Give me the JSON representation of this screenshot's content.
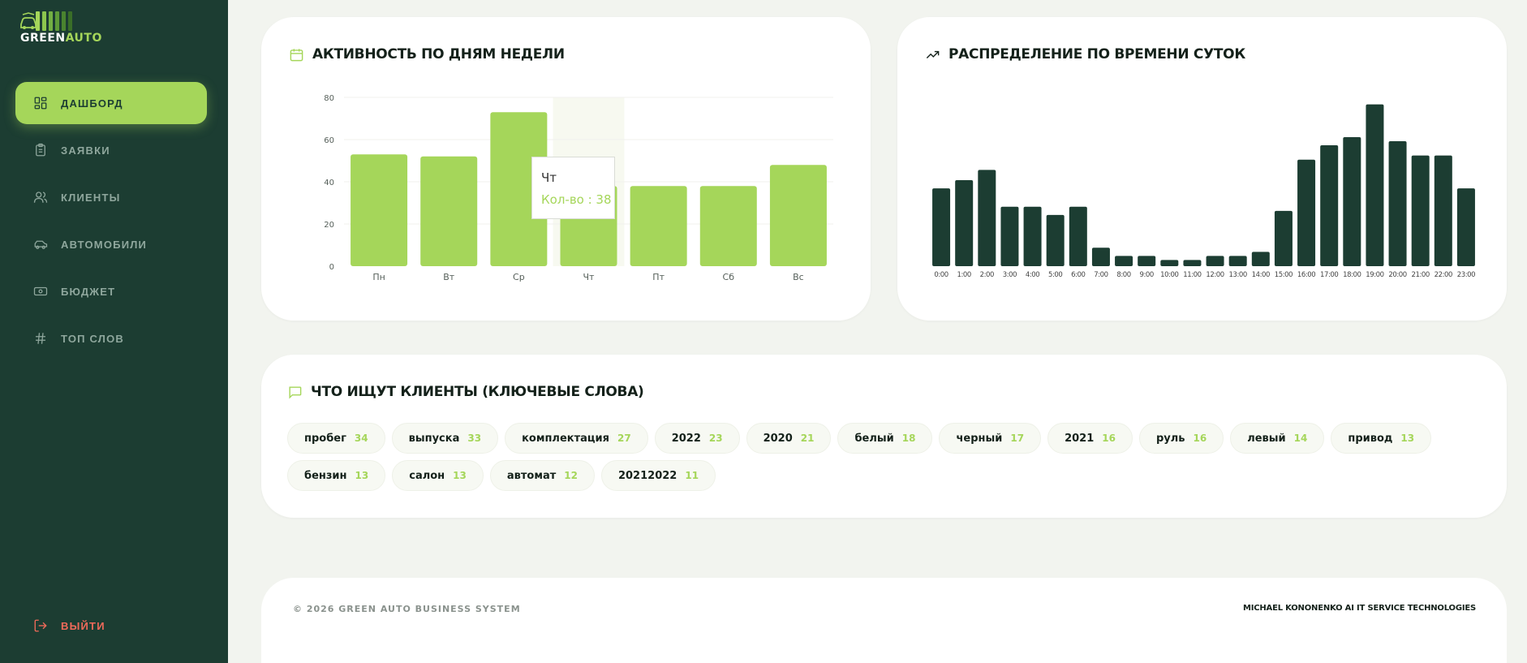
{
  "brand": {
    "word1": "GREEN",
    "word2": "AUTO",
    "bar_colors": [
      "#a5d65a",
      "#8cc64e",
      "#73b043",
      "#5d9a38",
      "#4a842f",
      "#3a6e28"
    ]
  },
  "colors": {
    "sidebar_bg": "#1c3d32",
    "accent": "#a5d65a",
    "dark_bar": "#1c3d32",
    "logout": "#f06a5a"
  },
  "nav": [
    {
      "label": "ДАШБОРД",
      "icon": "dashboard-icon",
      "active": true
    },
    {
      "label": "ЗАЯВКИ",
      "icon": "clipboard-icon",
      "active": false
    },
    {
      "label": "КЛИЕНТЫ",
      "icon": "users-icon",
      "active": false
    },
    {
      "label": "АВТОМОБИЛИ",
      "icon": "car-icon",
      "active": false
    },
    {
      "label": "БЮДЖЕТ",
      "icon": "banknote-icon",
      "active": false
    },
    {
      "label": "ТОП СЛОВ",
      "icon": "hash-icon",
      "active": false
    }
  ],
  "logout": {
    "label": "ВЫЙТИ",
    "icon": "logout-icon"
  },
  "weekday_card": {
    "title": "АКТИВНОСТЬ ПО ДНЯМ НЕДЕЛИ",
    "icon": "calendar-icon"
  },
  "hourly_card": {
    "title": "РАСПРЕДЕЛЕНИЕ ПО ВРЕМЕНИ СУТОК",
    "icon": "trending-up-icon"
  },
  "keywords_card": {
    "title": "ЧТО ИЩУТ КЛИЕНТЫ (КЛЮЧЕВЫЕ СЛОВА)",
    "icon": "message-square-icon",
    "items": [
      {
        "word": "пробег",
        "count": "34"
      },
      {
        "word": "выпуска",
        "count": "33"
      },
      {
        "word": "комплектация",
        "count": "27"
      },
      {
        "word": "2022",
        "count": "23"
      },
      {
        "word": "2020",
        "count": "21"
      },
      {
        "word": "белый",
        "count": "18"
      },
      {
        "word": "черный",
        "count": "17"
      },
      {
        "word": "2021",
        "count": "16"
      },
      {
        "word": "руль",
        "count": "16"
      },
      {
        "word": "левый",
        "count": "14"
      },
      {
        "word": "привод",
        "count": "13"
      },
      {
        "word": "бензин",
        "count": "13"
      },
      {
        "word": "салон",
        "count": "13"
      },
      {
        "word": "автомат",
        "count": "12"
      },
      {
        "word": "20212022",
        "count": "11"
      }
    ]
  },
  "tooltip": {
    "label": "Чт",
    "value_text": "Кол-во : 38"
  },
  "footer": {
    "left": "© 2026 GREEN AUTO BUSINESS SYSTEM",
    "right": "MICHAEL KONONENKO AI IT SERVICE TECHNOLOGIES"
  },
  "chart_data": [
    {
      "type": "bar",
      "categories": [
        "Пн",
        "Вт",
        "Ср",
        "Чт",
        "Пт",
        "Сб",
        "Вс"
      ],
      "values": [
        53,
        52,
        73,
        38,
        38,
        38,
        48
      ],
      "yticks": [
        0,
        20,
        40,
        60,
        80
      ],
      "ylim": [
        0,
        80
      ],
      "highlighted_category": "Чт",
      "grid": true
    },
    {
      "type": "bar",
      "categories": [
        "0:00",
        "1:00",
        "2:00",
        "3:00",
        "4:00",
        "5:00",
        "6:00",
        "7:00",
        "8:00",
        "9:00",
        "10:00",
        "11:00",
        "12:00",
        "13:00",
        "14:00",
        "15:00",
        "16:00",
        "17:00",
        "18:00",
        "19:00",
        "20:00",
        "21:00",
        "22:00",
        "23:00"
      ],
      "values": [
        38,
        42,
        47,
        29,
        29,
        25,
        29,
        9,
        5,
        5,
        3,
        3,
        5,
        5,
        7,
        27,
        52,
        59,
        63,
        79,
        61,
        54,
        54,
        38
      ],
      "ylim": [
        0,
        82
      ],
      "grid": false
    }
  ]
}
